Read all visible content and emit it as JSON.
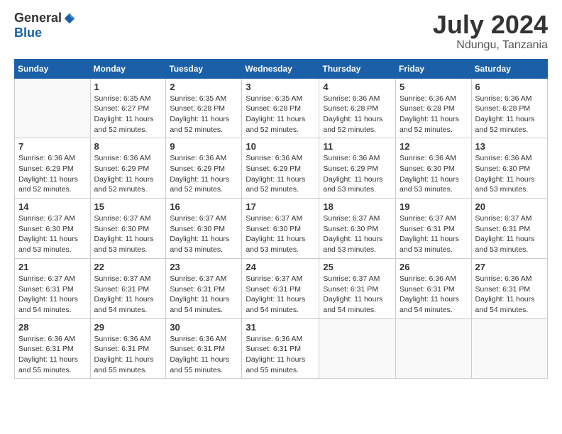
{
  "logo": {
    "general": "General",
    "blue": "Blue"
  },
  "title": {
    "month_year": "July 2024",
    "location": "Ndungu, Tanzania"
  },
  "weekdays": [
    "Sunday",
    "Monday",
    "Tuesday",
    "Wednesday",
    "Thursday",
    "Friday",
    "Saturday"
  ],
  "weeks": [
    [
      {
        "day": "",
        "info": ""
      },
      {
        "day": "1",
        "info": "Sunrise: 6:35 AM\nSunset: 6:27 PM\nDaylight: 11 hours\nand 52 minutes."
      },
      {
        "day": "2",
        "info": "Sunrise: 6:35 AM\nSunset: 6:28 PM\nDaylight: 11 hours\nand 52 minutes."
      },
      {
        "day": "3",
        "info": "Sunrise: 6:35 AM\nSunset: 6:28 PM\nDaylight: 11 hours\nand 52 minutes."
      },
      {
        "day": "4",
        "info": "Sunrise: 6:36 AM\nSunset: 6:28 PM\nDaylight: 11 hours\nand 52 minutes."
      },
      {
        "day": "5",
        "info": "Sunrise: 6:36 AM\nSunset: 6:28 PM\nDaylight: 11 hours\nand 52 minutes."
      },
      {
        "day": "6",
        "info": "Sunrise: 6:36 AM\nSunset: 6:28 PM\nDaylight: 11 hours\nand 52 minutes."
      }
    ],
    [
      {
        "day": "7",
        "info": "Sunrise: 6:36 AM\nSunset: 6:29 PM\nDaylight: 11 hours\nand 52 minutes."
      },
      {
        "day": "8",
        "info": "Sunrise: 6:36 AM\nSunset: 6:29 PM\nDaylight: 11 hours\nand 52 minutes."
      },
      {
        "day": "9",
        "info": "Sunrise: 6:36 AM\nSunset: 6:29 PM\nDaylight: 11 hours\nand 52 minutes."
      },
      {
        "day": "10",
        "info": "Sunrise: 6:36 AM\nSunset: 6:29 PM\nDaylight: 11 hours\nand 52 minutes."
      },
      {
        "day": "11",
        "info": "Sunrise: 6:36 AM\nSunset: 6:29 PM\nDaylight: 11 hours\nand 53 minutes."
      },
      {
        "day": "12",
        "info": "Sunrise: 6:36 AM\nSunset: 6:30 PM\nDaylight: 11 hours\nand 53 minutes."
      },
      {
        "day": "13",
        "info": "Sunrise: 6:36 AM\nSunset: 6:30 PM\nDaylight: 11 hours\nand 53 minutes."
      }
    ],
    [
      {
        "day": "14",
        "info": "Sunrise: 6:37 AM\nSunset: 6:30 PM\nDaylight: 11 hours\nand 53 minutes."
      },
      {
        "day": "15",
        "info": "Sunrise: 6:37 AM\nSunset: 6:30 PM\nDaylight: 11 hours\nand 53 minutes."
      },
      {
        "day": "16",
        "info": "Sunrise: 6:37 AM\nSunset: 6:30 PM\nDaylight: 11 hours\nand 53 minutes."
      },
      {
        "day": "17",
        "info": "Sunrise: 6:37 AM\nSunset: 6:30 PM\nDaylight: 11 hours\nand 53 minutes."
      },
      {
        "day": "18",
        "info": "Sunrise: 6:37 AM\nSunset: 6:30 PM\nDaylight: 11 hours\nand 53 minutes."
      },
      {
        "day": "19",
        "info": "Sunrise: 6:37 AM\nSunset: 6:31 PM\nDaylight: 11 hours\nand 53 minutes."
      },
      {
        "day": "20",
        "info": "Sunrise: 6:37 AM\nSunset: 6:31 PM\nDaylight: 11 hours\nand 53 minutes."
      }
    ],
    [
      {
        "day": "21",
        "info": "Sunrise: 6:37 AM\nSunset: 6:31 PM\nDaylight: 11 hours\nand 54 minutes."
      },
      {
        "day": "22",
        "info": "Sunrise: 6:37 AM\nSunset: 6:31 PM\nDaylight: 11 hours\nand 54 minutes."
      },
      {
        "day": "23",
        "info": "Sunrise: 6:37 AM\nSunset: 6:31 PM\nDaylight: 11 hours\nand 54 minutes."
      },
      {
        "day": "24",
        "info": "Sunrise: 6:37 AM\nSunset: 6:31 PM\nDaylight: 11 hours\nand 54 minutes."
      },
      {
        "day": "25",
        "info": "Sunrise: 6:37 AM\nSunset: 6:31 PM\nDaylight: 11 hours\nand 54 minutes."
      },
      {
        "day": "26",
        "info": "Sunrise: 6:36 AM\nSunset: 6:31 PM\nDaylight: 11 hours\nand 54 minutes."
      },
      {
        "day": "27",
        "info": "Sunrise: 6:36 AM\nSunset: 6:31 PM\nDaylight: 11 hours\nand 54 minutes."
      }
    ],
    [
      {
        "day": "28",
        "info": "Sunrise: 6:36 AM\nSunset: 6:31 PM\nDaylight: 11 hours\nand 55 minutes."
      },
      {
        "day": "29",
        "info": "Sunrise: 6:36 AM\nSunset: 6:31 PM\nDaylight: 11 hours\nand 55 minutes."
      },
      {
        "day": "30",
        "info": "Sunrise: 6:36 AM\nSunset: 6:31 PM\nDaylight: 11 hours\nand 55 minutes."
      },
      {
        "day": "31",
        "info": "Sunrise: 6:36 AM\nSunset: 6:31 PM\nDaylight: 11 hours\nand 55 minutes."
      },
      {
        "day": "",
        "info": ""
      },
      {
        "day": "",
        "info": ""
      },
      {
        "day": "",
        "info": ""
      }
    ]
  ]
}
